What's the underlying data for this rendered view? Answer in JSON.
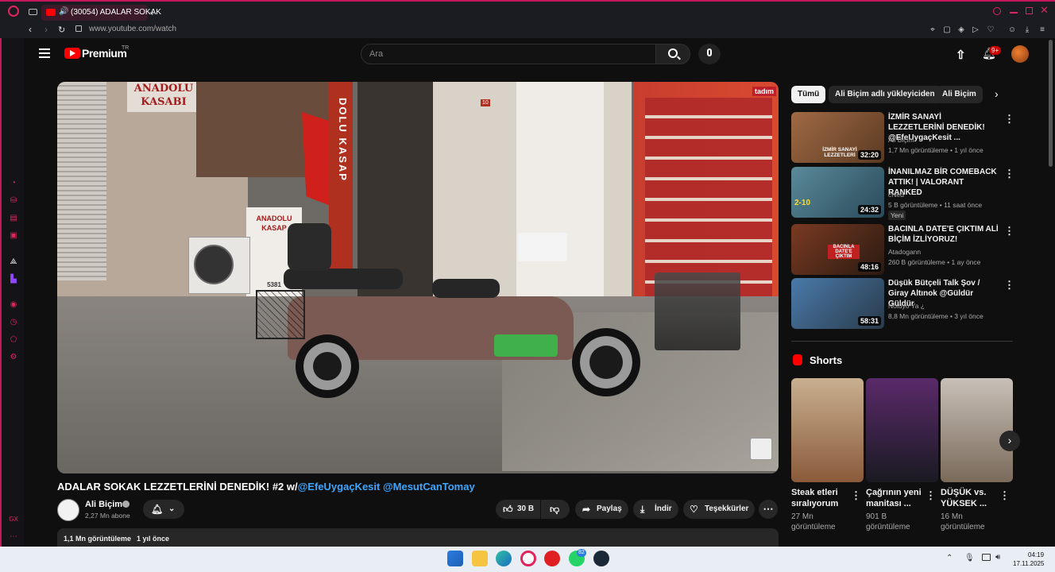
{
  "browser": {
    "tab_title": "(30054) ADALAR SOKAK",
    "url": "www.youtube.com/watch"
  },
  "header": {
    "logo_text": "Premium",
    "logo_superscript": "TR",
    "search_placeholder": "Ara",
    "notifications_badge": "9+"
  },
  "video": {
    "title_prefix": "ADALAR SOKAK LEZZETLERİNİ DENEDİK! #2 w/",
    "title_mention1": "@EfeUygaçKesit",
    "title_mention2": "@MesutCanTomay",
    "shop_sign1": "ANADOLU",
    "shop_sign2": "KASABI",
    "kasap_vertical": "DOLU KASAP",
    "shop_sign_small1": "ANADOLU",
    "shop_sign_small2": "KASAP",
    "phone_fragment": "5381",
    "shop_number": "10",
    "brand_sign": "tadım"
  },
  "channel": {
    "name": "Ali Biçim",
    "subscribers": "2,27 Mn abone"
  },
  "actions": {
    "likes": "30 B",
    "share": "Paylaş",
    "download": "İndir",
    "thanks": "Teşekkürler"
  },
  "description": {
    "views": "1,1 Mn görüntüleme",
    "age": "1 yıl önce"
  },
  "chips": [
    "Tümü",
    "Ali Biçim adlı yükleyiciden",
    "Ali Biçim"
  ],
  "recommendations": [
    {
      "title": "İZMİR SANAYİ LEZZETLERİNİ DENEDİK! @EfeUygaçKesit ...",
      "channel": "Ali Biçim",
      "meta": "1,7 Mn görüntüleme • 1 yıl önce",
      "duration": "32:20",
      "thumb_text": "İZMİR SANAYİ LEZZETLERİ",
      "thumb_color": "#7a4a2a"
    },
    {
      "title": "İNANILMAZ BİR COMEBACK ATTIK! | VALORANT RANKED",
      "channel": "cNed",
      "meta": "5 B görüntüleme • 11 saat önce",
      "duration": "24:32",
      "badge": "Yeni",
      "thumb_text": "2-10",
      "thumb_color": "#3a6a7a"
    },
    {
      "title": "BACINLA DATE'E ÇIKTIM ALİ BİÇİM İZLİYORUZ!",
      "channel": "Atadogann",
      "meta": "260 B görüntüleme • 1 ay önce",
      "duration": "48:16",
      "thumb_text": "BACINLA DATE'E ÇIKTIM",
      "thumb_color": "#5a2a1a"
    },
    {
      "title": "Düşük Bütçeli Talk Şov / Giray Altınok @Güldür Güldür",
      "channel": "Noluyo Ya ¿",
      "meta": "8,8 Mn görüntüleme • 3 yıl önce",
      "duration": "58:31",
      "thumb_color": "#3a6a9a"
    }
  ],
  "shorts": {
    "heading": "Shorts",
    "items": [
      {
        "title": "Steak etleri sıralıyorum",
        "views": "27 Mn görüntüleme",
        "color": "#8a5a3a"
      },
      {
        "title": "Çağrının yeni manitası ...",
        "views": "901 B görüntüleme",
        "color": "#2a2a3a"
      },
      {
        "title": "DÜŞÜK vs. YÜKSEK ...",
        "views": "16 Mn görüntüleme",
        "color": "#9a8a7a"
      }
    ]
  },
  "taskbar": {
    "whatsapp_badge": "82",
    "time": "04:19",
    "date": "17.11.2025"
  }
}
